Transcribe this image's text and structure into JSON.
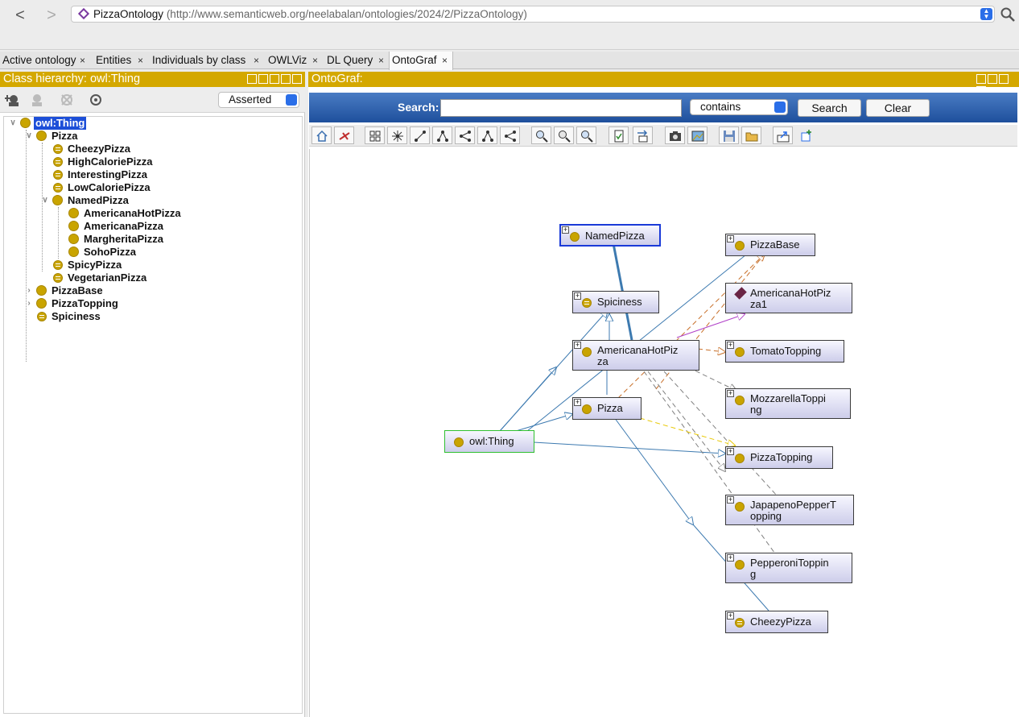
{
  "browser": {
    "url_title": "PizzaOntology",
    "url_address": "(http://www.semanticweb.org/neelabalan/ontologies/2024/2/PizzaOntology)",
    "nav_back": "<",
    "nav_forward": ">"
  },
  "tabs": [
    {
      "label": "Active ontology"
    },
    {
      "label": "Entities"
    },
    {
      "label": "Individuals by class"
    },
    {
      "label": "OWLViz"
    },
    {
      "label": "DL Query"
    },
    {
      "label": "OntoGraf"
    }
  ],
  "tab_close": "×",
  "class_hierarchy": {
    "title": "Class hierarchy: owl:Thing",
    "mode": "Asserted",
    "tree": [
      {
        "label": "owl:Thing",
        "selected": true
      },
      {
        "label": "Pizza"
      },
      {
        "label": "CheezyPizza",
        "defined": true
      },
      {
        "label": "HighCaloriePizza",
        "defined": true
      },
      {
        "label": "InterestingPizza",
        "defined": true
      },
      {
        "label": "LowCaloriePizza",
        "defined": true
      },
      {
        "label": "NamedPizza"
      },
      {
        "label": "AmericanaHotPizza"
      },
      {
        "label": "AmericanaPizza"
      },
      {
        "label": "MargheritaPizza"
      },
      {
        "label": "SohoPizza"
      },
      {
        "label": "SpicyPizza",
        "defined": true
      },
      {
        "label": "VegetarianPizza",
        "defined": true
      },
      {
        "label": "PizzaBase"
      },
      {
        "label": "PizzaTopping"
      },
      {
        "label": "Spiciness",
        "defined": true
      }
    ]
  },
  "ontograf": {
    "title": "OntoGraf:",
    "search_label": "Search:",
    "search_value": "",
    "match_mode": "contains",
    "search_button": "Search",
    "clear_button": "Clear",
    "nodes": [
      {
        "label": "NamedPizza",
        "kind": "class"
      },
      {
        "label": "Spiciness",
        "kind": "defined"
      },
      {
        "label": "AmericanaHotPiz\nza",
        "kind": "class"
      },
      {
        "label": "Pizza",
        "kind": "class"
      },
      {
        "label": "owl:Thing",
        "kind": "class"
      },
      {
        "label": "PizzaBase",
        "kind": "class"
      },
      {
        "label": "AmericanaHotPiz\nza1",
        "kind": "individual"
      },
      {
        "label": "TomatoTopping",
        "kind": "class"
      },
      {
        "label": "MozzarellaToppi\nng",
        "kind": "class"
      },
      {
        "label": "PizzaTopping",
        "kind": "class"
      },
      {
        "label": "JapapenoPepperT\nopping",
        "kind": "class"
      },
      {
        "label": "PepperoniToppin\ng",
        "kind": "class"
      },
      {
        "label": "CheezyPizza",
        "kind": "defined"
      }
    ]
  },
  "colors": {
    "header_gold": "#d4a800",
    "class_dot": "#c9a400",
    "selection_blue": "#1d4fd8",
    "search_bar_blue": "#2a5ca8",
    "subclass_edge": "#3d7ab0",
    "has_topping_edge": "#c8702a",
    "individual_edge": "#b040c8",
    "disjoint_edge": "#e8c800",
    "other_edge": "#808080"
  }
}
